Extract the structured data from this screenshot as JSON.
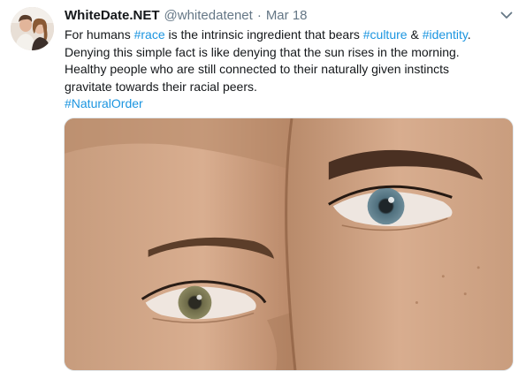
{
  "author": {
    "display_name": "WhiteDate.NET",
    "handle": "@whitedatenet",
    "separator": "·",
    "date": "Mar 18"
  },
  "icons": {
    "avatar": "profile-photo-couple",
    "menu": "chevron-down-icon"
  },
  "tweet": {
    "lines": [
      [
        {
          "text": "For humans ",
          "kind": "text"
        },
        {
          "text": "#race",
          "kind": "hashtag"
        },
        {
          "text": " is the intrinsic ingredient that bears ",
          "kind": "text"
        },
        {
          "text": "#culture",
          "kind": "hashtag"
        },
        {
          "text": " & ",
          "kind": "text"
        },
        {
          "text": "#identity",
          "kind": "hashtag"
        },
        {
          "text": ".",
          "kind": "text"
        }
      ],
      [
        {
          "text": "Denying this simple fact is like denying that the sun rises in the morning.",
          "kind": "text"
        }
      ],
      [
        {
          "text": "Healthy people who are still connected to their naturally given instincts",
          "kind": "text"
        }
      ],
      [
        {
          "text": "gravitate towards their racial peers.",
          "kind": "text"
        }
      ],
      [
        {
          "text": "#NaturalOrder",
          "kind": "hashtag"
        }
      ]
    ]
  },
  "media": {
    "description_icon": "photo-two-faces-eyes"
  },
  "colors": {
    "text": "#14171a",
    "muted": "#657786",
    "link": "#1b95e0"
  }
}
